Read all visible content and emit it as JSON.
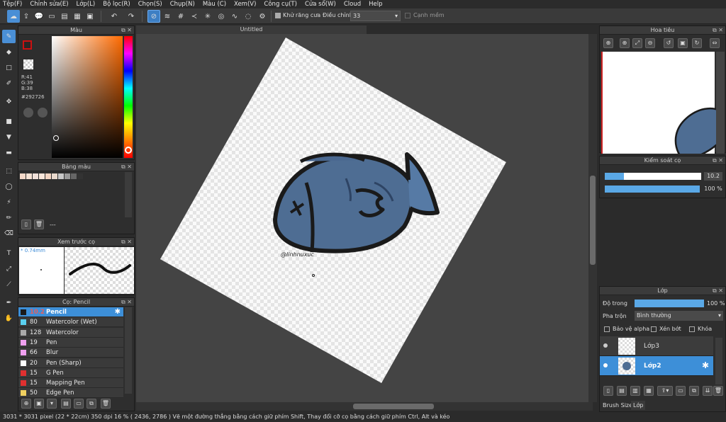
{
  "menu": [
    "Tệp(F)",
    "Chỉnh sửa(E)",
    "Lớp(L)",
    "Bộ lọc(R)",
    "Chọn(S)",
    "Chụp(N)",
    "Màu (C)",
    "Xem(V)",
    "Công cụ(T)",
    "Cửa sổ(W)",
    "Cloud",
    "Help"
  ],
  "toolbar": {
    "antialias": "Khử răng cưa",
    "adjust_label": "Điều chỉnh",
    "adjust_value": "33",
    "smooth": "Cạnh mềm"
  },
  "color_panel": {
    "title": "Màu",
    "r": "R:41",
    "g": "G:39",
    "b": "B:38",
    "hex": "#292726",
    "fg": "#292726",
    "accent": "#cc1111"
  },
  "palette_panel": {
    "title": "Bảng màu",
    "none": "---"
  },
  "preview_panel": {
    "title": "Xem trước cọ",
    "size": "* 0.74mm"
  },
  "brush_panel": {
    "title": "Cọ: Pencil",
    "items": [
      {
        "size": "10.2",
        "name": "Pencil",
        "color": "#1a1a1a"
      },
      {
        "size": "80",
        "name": "Watercolor (Wet)",
        "color": "#5ad0f0"
      },
      {
        "size": "128",
        "name": "Watercolor",
        "color": "#aaaaaa"
      },
      {
        "size": "19",
        "name": "Pen",
        "color": "#f0a0f0"
      },
      {
        "size": "66",
        "name": "Blur",
        "color": "#f0a0f0"
      },
      {
        "size": "20",
        "name": "Pen (Sharp)",
        "color": "#ffffff"
      },
      {
        "size": "15",
        "name": "G Pen",
        "color": "#e03030"
      },
      {
        "size": "15",
        "name": "Mapping Pen",
        "color": "#e03030"
      },
      {
        "size": "50",
        "name": "Edge Pen",
        "color": "#f0d060"
      }
    ]
  },
  "document": {
    "tab": "Untitled",
    "signature": "@linhnuxuc"
  },
  "navigator": {
    "title": "Hoa tiêu"
  },
  "brush_control": {
    "title": "Kiểm soát cọ",
    "size": "10.2",
    "opacity": "100 %",
    "size_fraction": 0.2,
    "opacity_fraction": 1.0
  },
  "layers": {
    "title": "Lớp",
    "opacity_label": "Độ trong",
    "opacity_value": "100 %",
    "blend_label": "Pha trộn",
    "blend_value": "Bình thường",
    "protect": "Bảo vệ alpha",
    "clip": "Xén bớt",
    "lock": "Khóa",
    "items": [
      "Lớp3",
      "Lớp2"
    ],
    "tab_brush": "Brush Size",
    "tab_layer": "Lớp"
  },
  "status": "3031 * 3031 pixel   (22 * 22cm)   350 dpi   16 %   ( 2436, 2786 )   Vẽ một đường thẳng bằng cách giữ phím Shift, Thay đổi cỡ cọ bằng cách giữ phím Ctrl, Alt và kéo"
}
